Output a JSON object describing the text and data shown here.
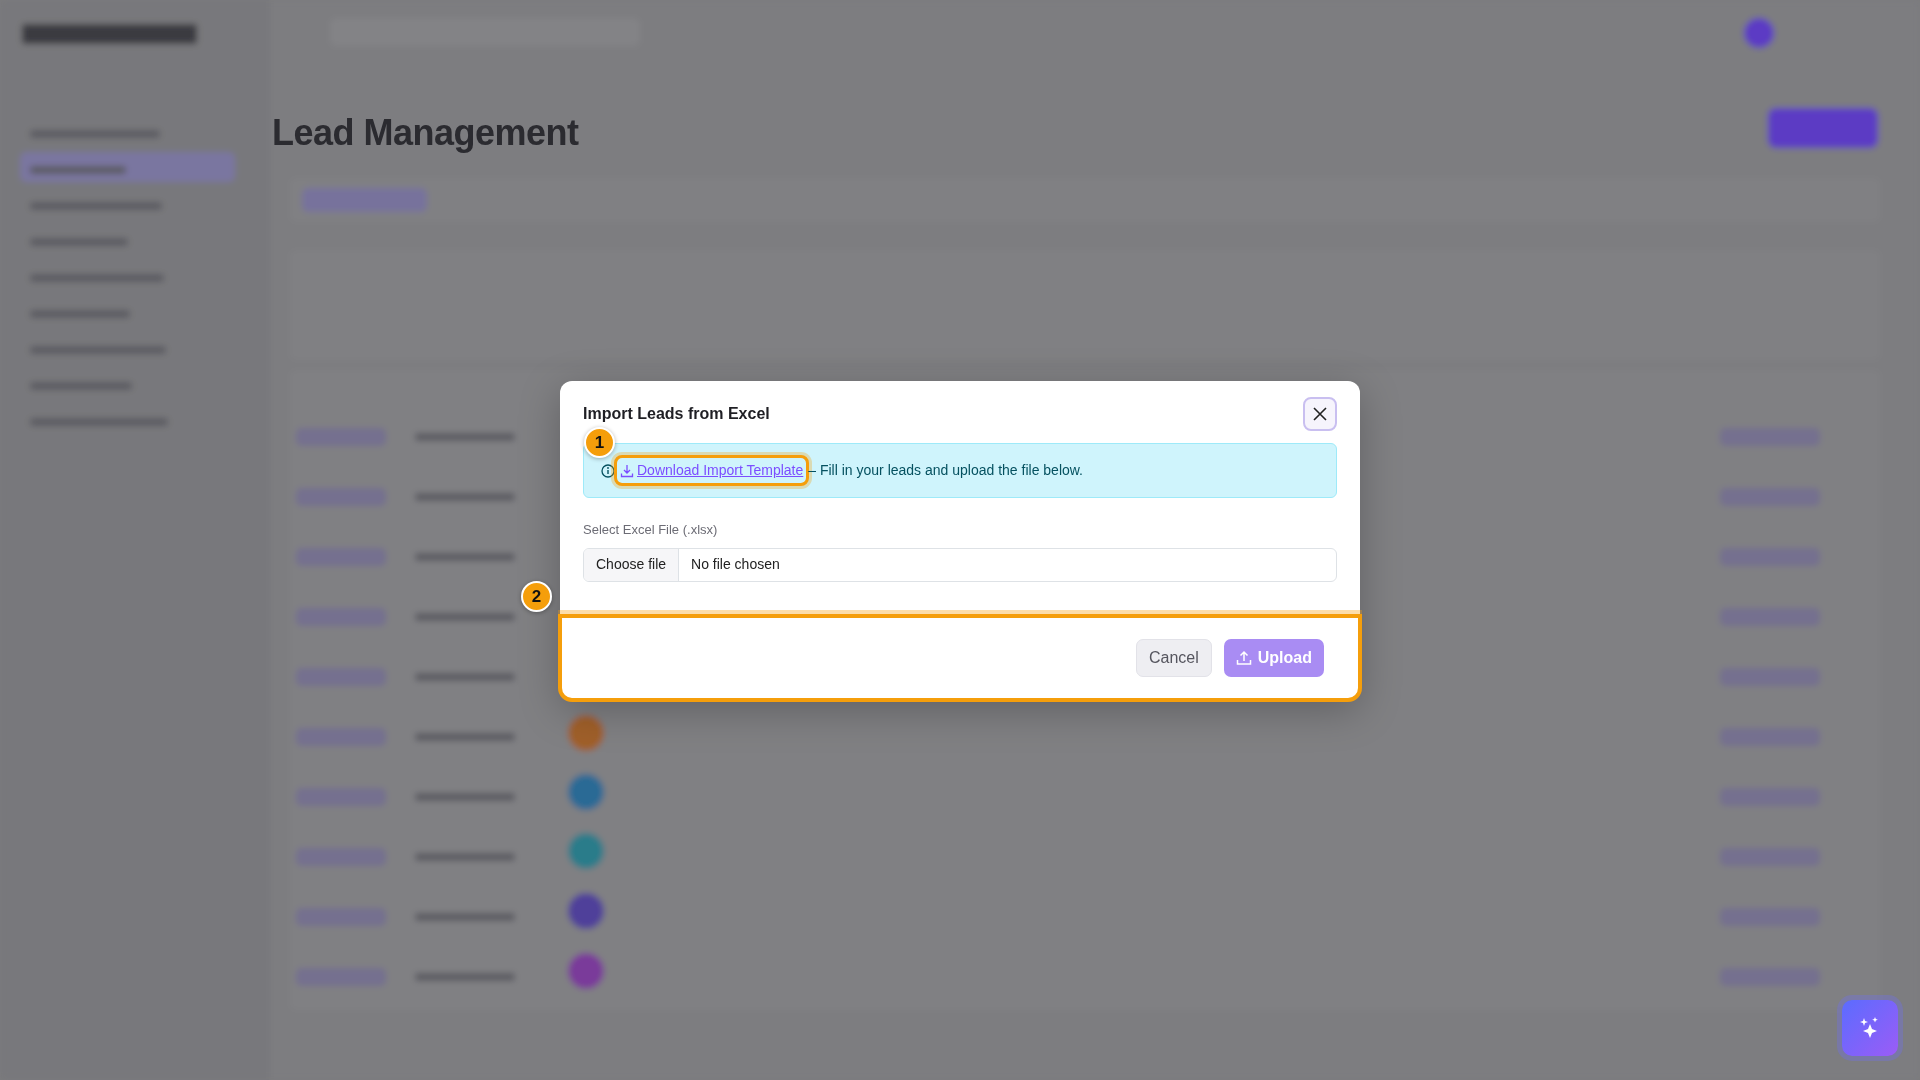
{
  "page": {
    "title": "Lead Management"
  },
  "modal": {
    "title": "Import Leads from Excel",
    "info": {
      "link": "Download Import Template",
      "text": "– Fill in your leads and upload the file below."
    },
    "file_field": {
      "label": "Select Excel File (.xlsx)",
      "button": "Choose file",
      "value": "No file chosen"
    },
    "buttons": [
      {
        "label": "Cancel",
        "kind": "secondary",
        "disabled": false
      },
      {
        "label": "Upload",
        "kind": "primary",
        "disabled": true
      }
    ]
  },
  "annotations": [
    {
      "number": "1",
      "kind": "link"
    },
    {
      "number": "2",
      "kind": "footer"
    }
  ]
}
